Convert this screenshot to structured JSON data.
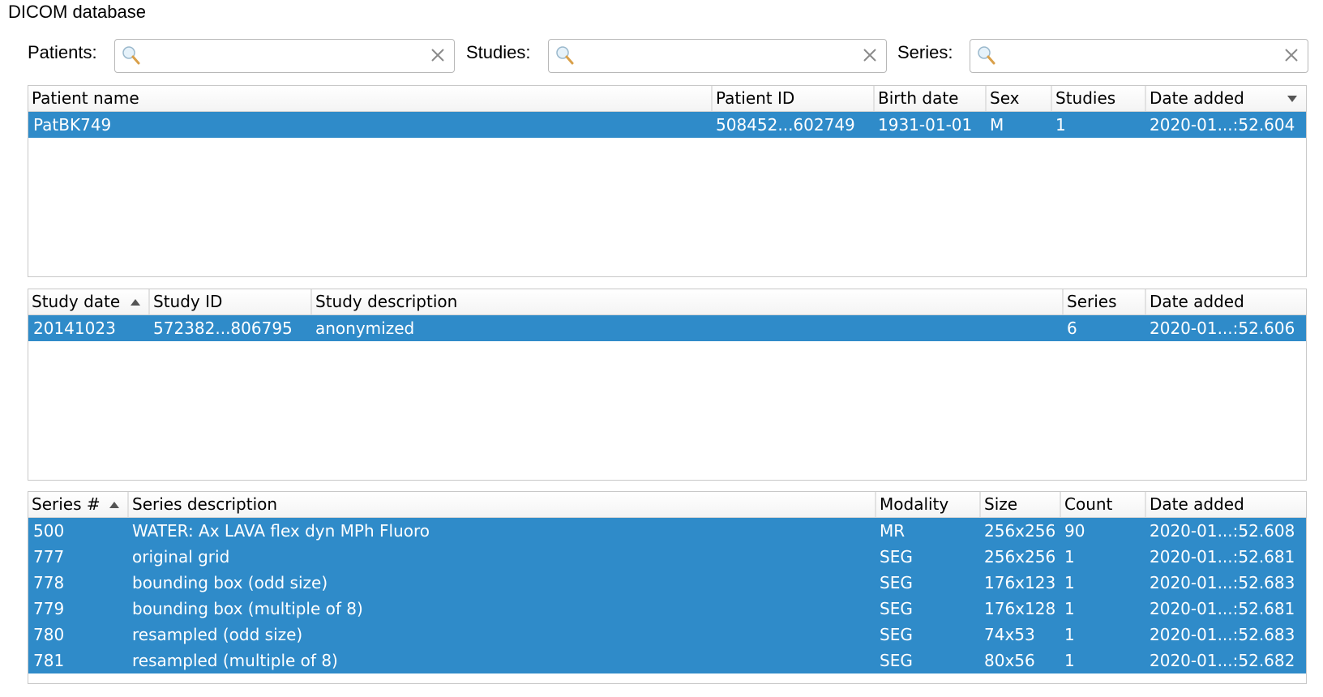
{
  "window": {
    "title": "DICOM database"
  },
  "filters": [
    {
      "label": "Patients:",
      "value": "",
      "placeholder": ""
    },
    {
      "label": "Studies:",
      "value": "",
      "placeholder": ""
    },
    {
      "label": "Series:",
      "value": "",
      "placeholder": ""
    }
  ],
  "colors": {
    "selection": "#2f8bc9",
    "selection_text": "#ffffff"
  },
  "patients": {
    "columns": [
      {
        "label": "Patient name"
      },
      {
        "label": "Patient ID"
      },
      {
        "label": "Birth date"
      },
      {
        "label": "Sex"
      },
      {
        "label": "Studies"
      },
      {
        "label": "Date added",
        "sort": "descending"
      }
    ],
    "rows": [
      [
        "PatBK749",
        "508452...602749",
        "1931-01-01",
        "M",
        "1",
        "2020-01...:52.604"
      ]
    ]
  },
  "studies": {
    "columns": [
      {
        "label": "Study date",
        "sort": "ascending"
      },
      {
        "label": "Study ID"
      },
      {
        "label": "Study description"
      },
      {
        "label": "Series"
      },
      {
        "label": "Date added"
      }
    ],
    "rows": [
      [
        "20141023",
        "572382...806795",
        "anonymized",
        "6",
        "2020-01...:52.606"
      ]
    ]
  },
  "series": {
    "columns": [
      {
        "label": "Series #",
        "sort": "ascending"
      },
      {
        "label": "Series description"
      },
      {
        "label": "Modality"
      },
      {
        "label": "Size"
      },
      {
        "label": "Count"
      },
      {
        "label": "Date added"
      }
    ],
    "rows": [
      [
        "500",
        "WATER: Ax LAVA flex dyn MPh Fluoro",
        "MR",
        "256x256",
        "90",
        "2020-01...:52.608"
      ],
      [
        "777",
        "original grid",
        "SEG",
        "256x256",
        "1",
        "2020-01...:52.681"
      ],
      [
        "778",
        "bounding box (odd size)",
        "SEG",
        "176x123",
        "1",
        "2020-01...:52.683"
      ],
      [
        "779",
        "bounding box (multiple of 8)",
        "SEG",
        "176x128",
        "1",
        "2020-01...:52.681"
      ],
      [
        "780",
        "resampled (odd size)",
        "SEG",
        "74x53",
        "1",
        "2020-01...:52.683"
      ],
      [
        "781",
        "resampled (multiple of 8)",
        "SEG",
        "80x56",
        "1",
        "2020-01...:52.682"
      ]
    ]
  }
}
